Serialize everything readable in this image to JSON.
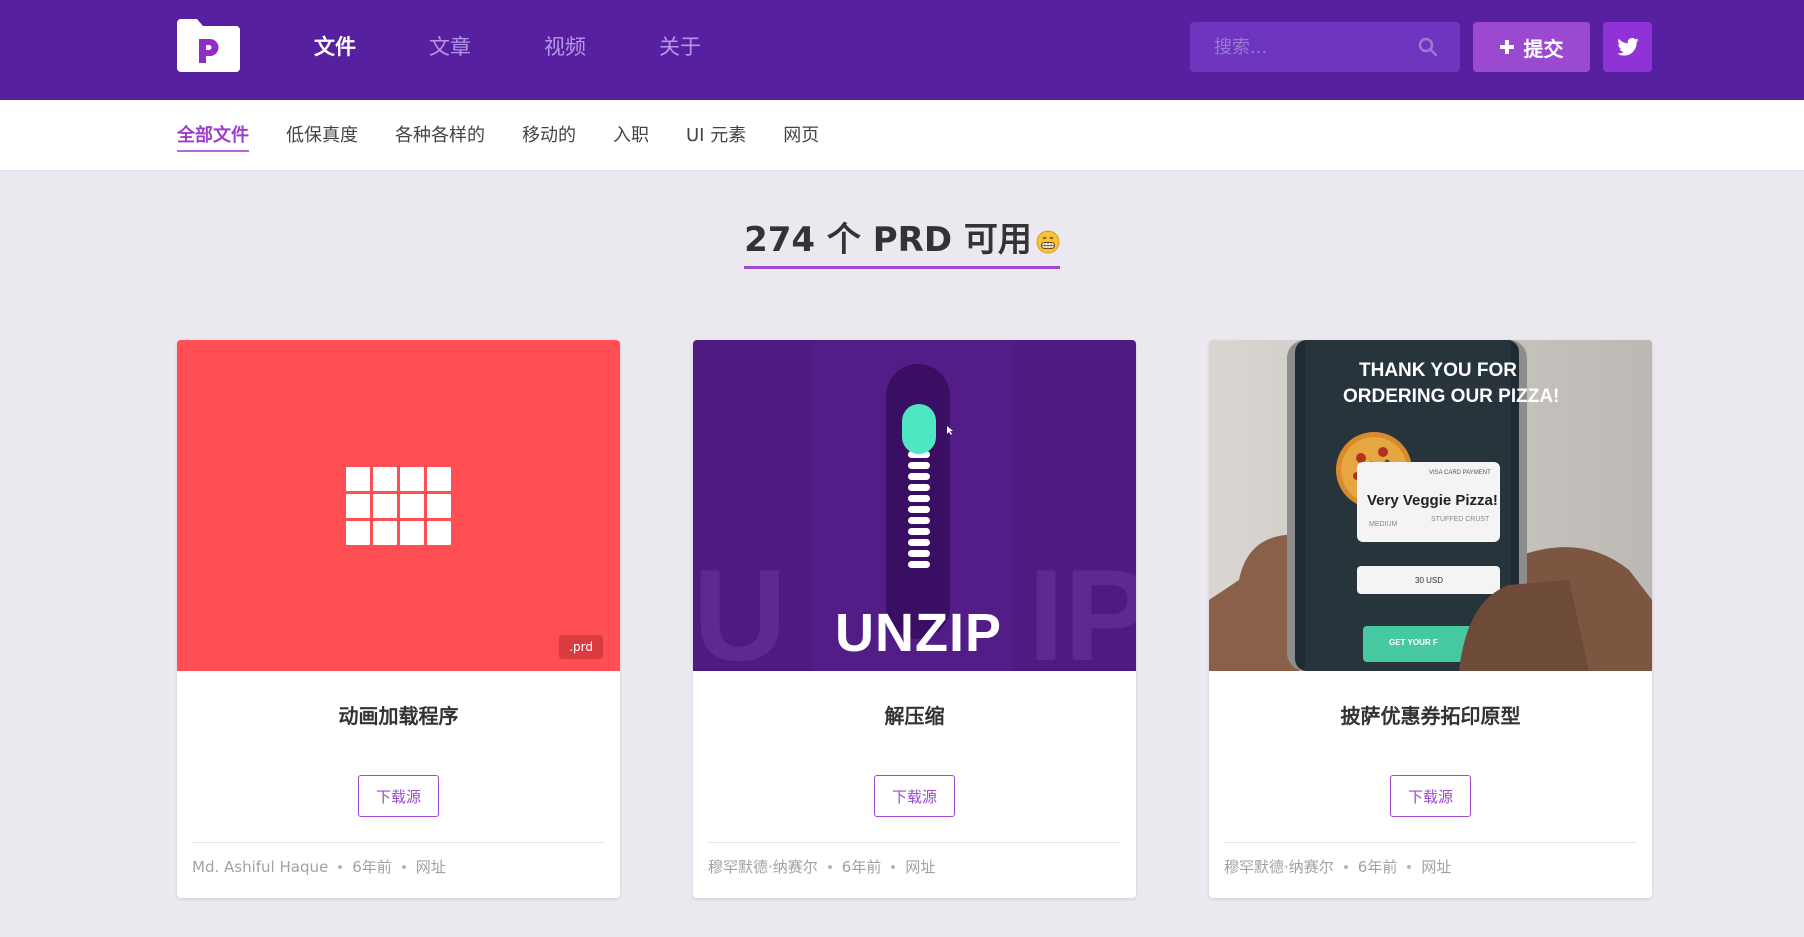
{
  "nav": {
    "items": [
      {
        "label": "文件",
        "active": true
      },
      {
        "label": "文章",
        "active": false
      },
      {
        "label": "视频",
        "active": false
      },
      {
        "label": "关于",
        "active": false
      }
    ],
    "search_placeholder": "搜索...",
    "submit_label": "提交"
  },
  "categories": [
    {
      "label": "全部文件",
      "active": true
    },
    {
      "label": "低保真度",
      "active": false
    },
    {
      "label": "各种各样的",
      "active": false
    },
    {
      "label": "移动的",
      "active": false
    },
    {
      "label": "入职",
      "active": false
    },
    {
      "label": "UI 元素",
      "active": false
    },
    {
      "label": "网页",
      "active": false
    }
  ],
  "headline": "274 个 PRD 可用",
  "cards": [
    {
      "title": "动画加载程序",
      "download_label": "下载源",
      "badge": ".prd",
      "author": "Md. Ashiful Haque",
      "time": "6年前",
      "link": "网址"
    },
    {
      "title": "解压缩",
      "download_label": "下载源",
      "thumb_text": "UNZIP",
      "author": "穆罕默德·纳赛尔",
      "time": "6年前",
      "link": "网址"
    },
    {
      "title": "披萨优惠券拓印原型",
      "download_label": "下载源",
      "thumb_text": {
        "line1": "THANK YOU FOR",
        "line2": "ORDERING OUR PIZZA!",
        "card_brand": "VISA CARD PAYMENT",
        "pizza_name": "Very Veggie Pizza!",
        "size": "MEDIUM",
        "crust": "STUFFED CRUST",
        "price": "30 USD",
        "cta": "GET YOUR F"
      },
      "author": "穆罕默德·纳赛尔",
      "time": "6年前",
      "link": "网址"
    }
  ],
  "colors": {
    "header_bg": "#5620a1",
    "accent": "#9b4ad0",
    "card1_bg": "#ff4f55",
    "card2_bg": "#4f1a82",
    "page_bg": "#ebe9ef"
  }
}
